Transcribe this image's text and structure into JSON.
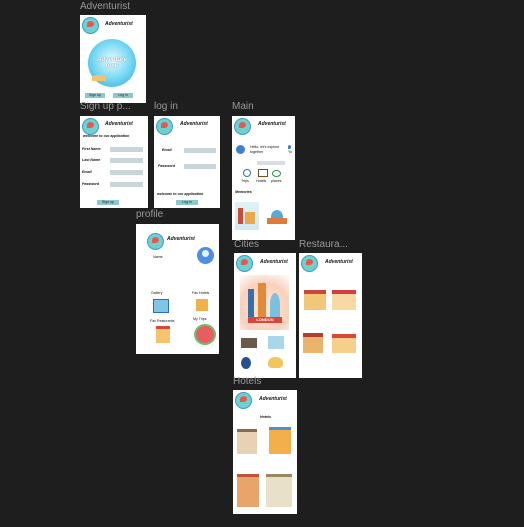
{
  "app_title": "Adventurist",
  "frames": {
    "splash": {
      "label": "Adventurist",
      "hero_text": "Adventure time",
      "signup_btn": "Sign up",
      "login_btn": "Log in"
    },
    "signup": {
      "label": "Sign up p...",
      "welcome": "welcome to our application",
      "first_name": "First Name",
      "last_name": "Last Name",
      "email": "Email",
      "password": "Password",
      "submit": "Sign up"
    },
    "login": {
      "label": "log in",
      "email": "Email",
      "password": "Password",
      "welcome": "welcome to our application",
      "submit": "Log in"
    },
    "main": {
      "label": "Main",
      "greeting": "Hello, let's explore together",
      "greeting_extra": "Yo",
      "trips": "Trips",
      "hotels": "Hotels",
      "places": "places",
      "memories": "Memories"
    },
    "profile": {
      "label": "profile",
      "name": "Name",
      "gallery": "Gallery",
      "fav_hotels": "Fav Hotels",
      "fav_restaurants": "Fav Resturants",
      "my_trips": "My Trips"
    },
    "cities": {
      "label": "Cities",
      "city_name": "LONDON"
    },
    "restaurants": {
      "label": "Restaura..."
    },
    "hotels": {
      "label": "Hotels",
      "heading": "Hotels"
    }
  },
  "colors": {
    "canvas": "#1e1e1e",
    "frame_label": "#9a9a9a",
    "input": "#c9d6d9",
    "button": "#8dc9cb",
    "logo": "#6fd1cf",
    "pin": "#e8584f"
  }
}
